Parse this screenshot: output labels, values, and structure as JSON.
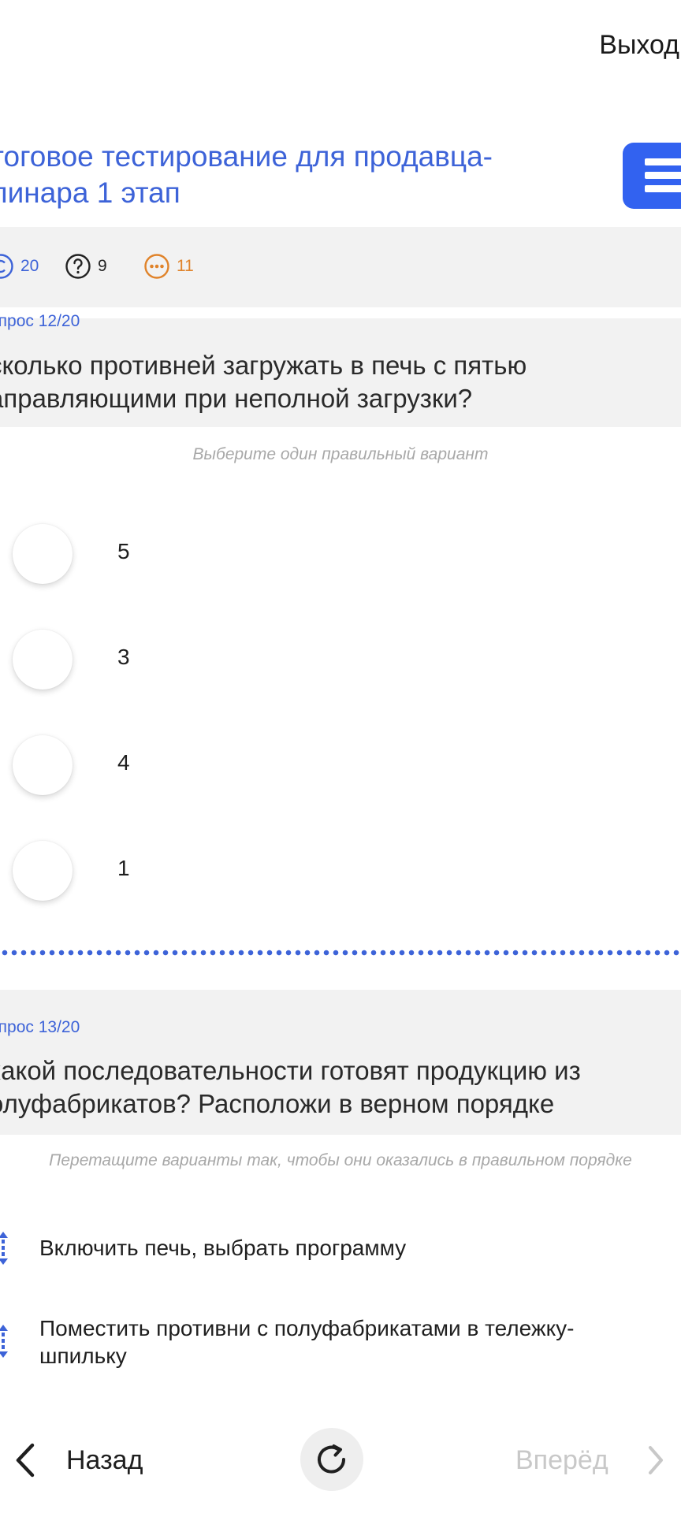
{
  "header": {
    "exit_label": "Выход",
    "title": "тоговое тестирование для продавца-\nлинара 1 этап"
  },
  "stats": {
    "total": "20",
    "unanswered": "9",
    "remaining": "11"
  },
  "question12": {
    "number": "опрос 12/20",
    "text": "сколько противней загружать в печь с пятью\nаправляющими при неполной загрузки?",
    "hint": "Выберите один правильный вариант",
    "options": [
      "5",
      "3",
      "4",
      "1"
    ]
  },
  "question13": {
    "number": "опрос 13/20",
    "text": " какой последовательности готовят продукцию из\nолуфабрикатов? Расположи в верном порядке",
    "hint": "Перетащите варианты так, чтобы они оказались в правильном порядке",
    "items": [
      "Включить печь, выбрать программу",
      "Поместить противни с полуфабрикатами в тележку-\nшпильку"
    ]
  },
  "footer": {
    "back_label": "Назад",
    "forward_label": "Вперёд"
  },
  "colors": {
    "accent": "#3262f0",
    "link_blue": "#3d63d8",
    "orange": "#e0832a",
    "panel_bg": "#f2f2f2"
  },
  "icons": {
    "total": "copyright-circle-icon",
    "unanswered": "question-circle-icon",
    "remaining": "dots-circle-icon",
    "menu": "hamburger-menu-icon",
    "drag": "drag-handle-icon",
    "back": "chevron-left-icon",
    "forward": "chevron-right-icon",
    "reload": "reload-icon"
  }
}
